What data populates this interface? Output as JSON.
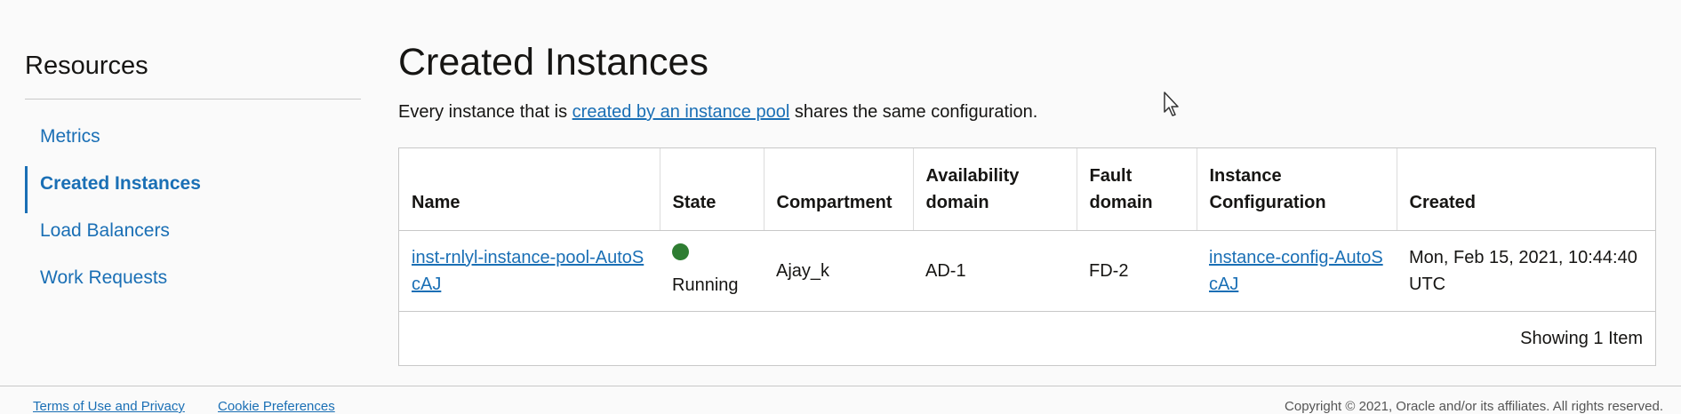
{
  "sidebar": {
    "title": "Resources",
    "items": [
      {
        "label": "Metrics",
        "active": false
      },
      {
        "label": "Created Instances",
        "active": true
      },
      {
        "label": "Load Balancers",
        "active": false
      },
      {
        "label": "Work Requests",
        "active": false
      }
    ]
  },
  "main": {
    "title": "Created Instances",
    "intro_prefix": "Every instance that is ",
    "intro_link": "created by an instance pool",
    "intro_suffix": " shares the same configuration.",
    "table": {
      "columns": [
        "Name",
        "State",
        "Compartment",
        "Availability domain",
        "Fault domain",
        "Instance Configuration",
        "Created"
      ],
      "rows": [
        {
          "name": "inst-rnlyl-instance-pool-AutoScAJ",
          "state": "Running",
          "state_color": "#2e7d32",
          "compartment": "Ajay_k",
          "availability_domain": "AD-1",
          "fault_domain": "FD-2",
          "instance_configuration": "instance-config-AutoScAJ",
          "created": "Mon, Feb 15, 2021, 10:44:40 UTC"
        }
      ],
      "footer": "Showing 1 Item"
    }
  },
  "footer": {
    "terms": "Terms of Use and Privacy",
    "cookies": "Cookie Preferences",
    "copyright": "Copyright © 2021, Oracle and/or its affiliates. All rights reserved."
  },
  "colors": {
    "link": "#1a6fb5",
    "running": "#2e7d32"
  },
  "cursor_icon": "mouse-pointer-icon"
}
